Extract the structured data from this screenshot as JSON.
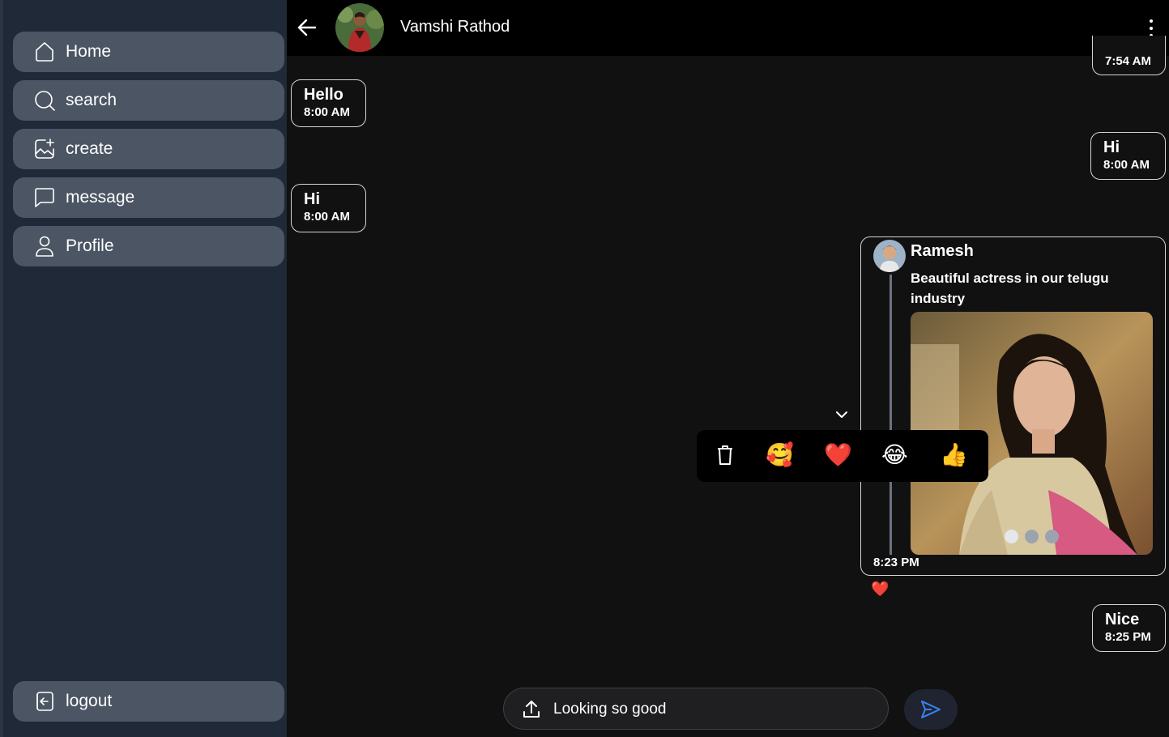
{
  "sidebar": {
    "items": [
      {
        "label": "Home",
        "icon": "home-icon"
      },
      {
        "label": "search",
        "icon": "search-icon"
      },
      {
        "label": "create",
        "icon": "create-image-icon"
      },
      {
        "label": "message",
        "icon": "message-icon"
      },
      {
        "label": "Profile",
        "icon": "profile-icon"
      }
    ],
    "logout": {
      "label": "logout",
      "icon": "logout-icon"
    }
  },
  "header": {
    "name": "Vamshi Rathod",
    "back_icon": "back-arrow-icon",
    "menu_icon": "more-vertical-icon"
  },
  "messages": [
    {
      "side": "right",
      "text": "",
      "time": "7:54 AM"
    },
    {
      "side": "left",
      "text": "Hello",
      "time": "8:00 AM"
    },
    {
      "side": "right",
      "text": "Hi",
      "time": "8:00 AM"
    },
    {
      "side": "left",
      "text": "Hi",
      "time": "8:00 AM"
    },
    {
      "side": "right",
      "text": "Nice",
      "time": "8:25 PM"
    }
  ],
  "shared_post": {
    "user": "Ramesh",
    "caption": "Beautiful actress in our telugu industry",
    "time": "8:23 PM",
    "reaction": "❤️",
    "carousel_count": 3,
    "carousel_active": 1
  },
  "reaction_bar": {
    "options": [
      {
        "type": "icon",
        "name": "trash-icon"
      },
      {
        "type": "emoji",
        "value": "🥰"
      },
      {
        "type": "emoji",
        "value": "❤️"
      },
      {
        "type": "emoji",
        "value": "😂"
      },
      {
        "type": "emoji",
        "value": "👍"
      }
    ]
  },
  "composer": {
    "value": "Looking so good",
    "upload_icon": "upload-icon",
    "send_icon": "send-icon"
  },
  "colors": {
    "sidebar_bg": "#1f2937",
    "nav_item_bg": "#4b5563",
    "chat_bg": "#111111",
    "header_bg": "#000000",
    "send_accent": "#3b82f6"
  }
}
